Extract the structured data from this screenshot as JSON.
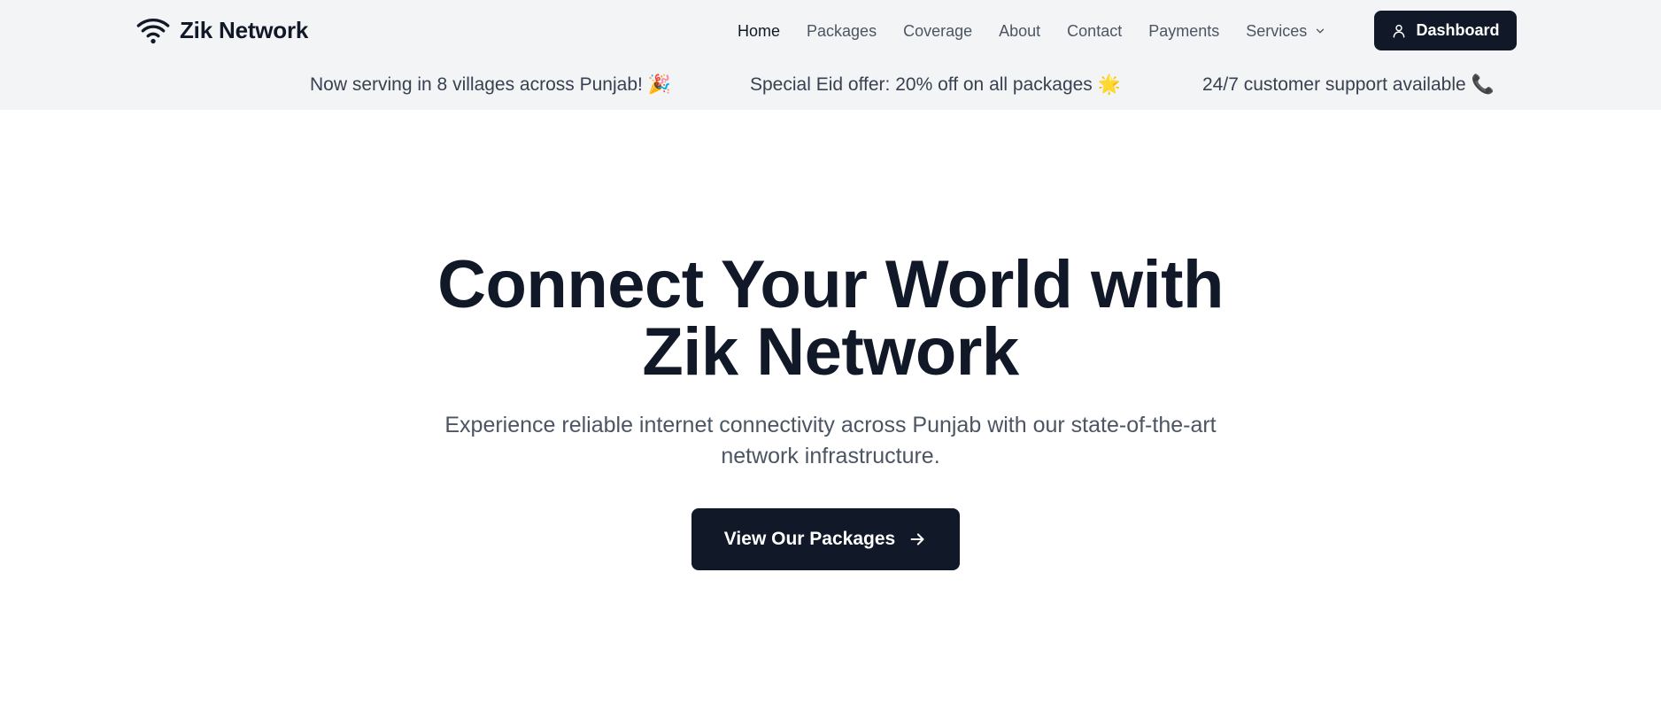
{
  "brand": {
    "name": "Zik Network",
    "icon": "wifi-icon"
  },
  "nav": {
    "items": [
      {
        "label": "Home",
        "active": true
      },
      {
        "label": "Packages"
      },
      {
        "label": "Coverage"
      },
      {
        "label": "About"
      },
      {
        "label": "Contact"
      },
      {
        "label": "Payments"
      },
      {
        "label": "Services",
        "icon": "chevron-down-icon"
      }
    ],
    "dashboard_label": "Dashboard",
    "dashboard_icon": "user-icon"
  },
  "announcements": [
    "Now serving in 8 villages across Punjab! 🎉",
    "Special Eid offer: 20% off on all packages 🌟",
    "24/7 customer support available 📞"
  ],
  "hero": {
    "title": "Connect Your World with Zik Network",
    "subtitle": "Experience reliable internet connectivity across Punjab with our state-of-the-art network infrastructure.",
    "cta_label": "View Our Packages",
    "cta_icon": "arrow-right-icon"
  },
  "colors": {
    "primary": "#111827",
    "topbar_bg": "#f3f4f6",
    "muted_text": "#4b5563"
  }
}
